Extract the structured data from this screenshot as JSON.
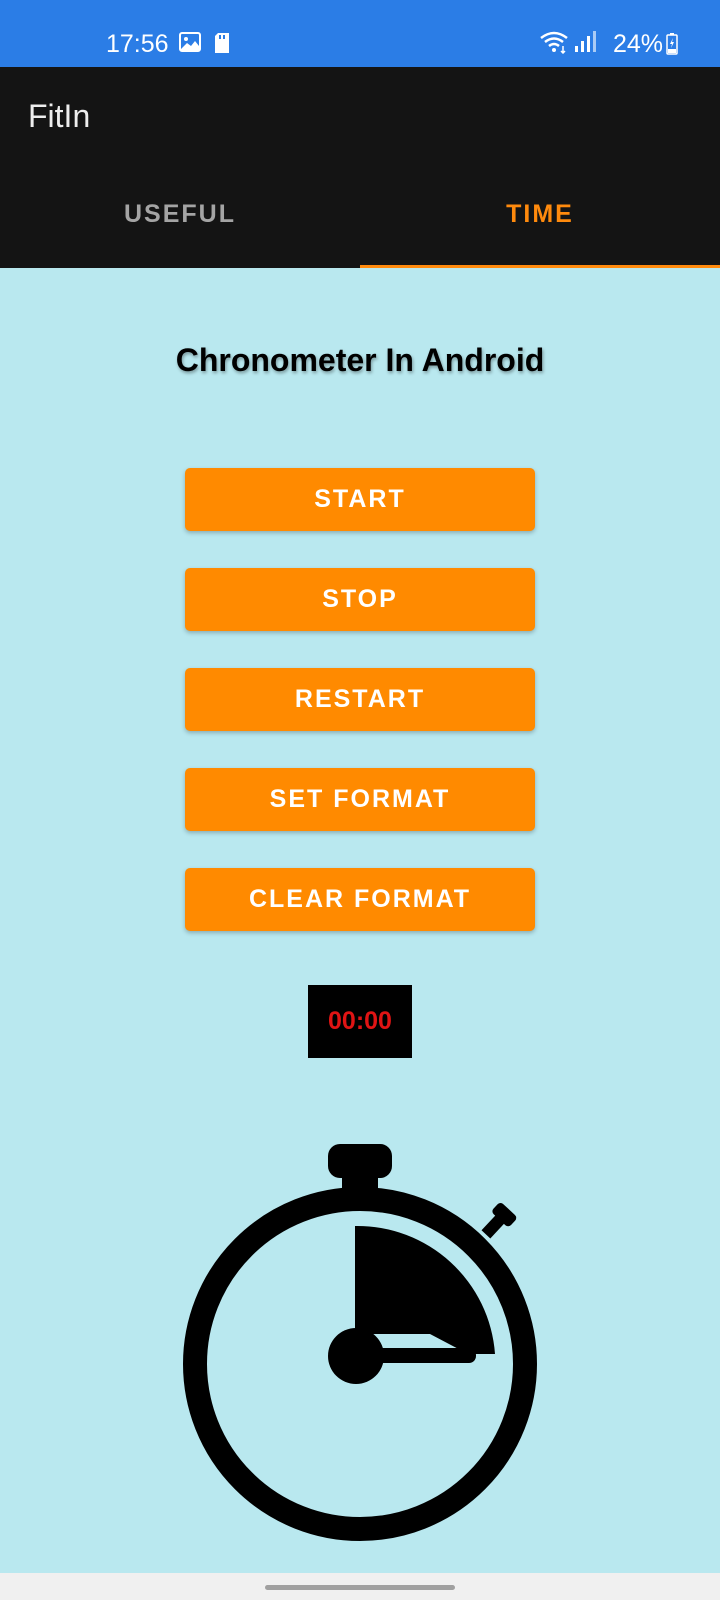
{
  "status_bar": {
    "time": "17:56",
    "battery": "24%",
    "icons": [
      "gallery-icon",
      "sd-card-icon",
      "wifi-icon",
      "signal-icon",
      "battery-icon"
    ]
  },
  "app_bar": {
    "title": "FitIn",
    "tabs": [
      {
        "label": "USEFUL",
        "selected": false
      },
      {
        "label": "TIME",
        "selected": true
      }
    ]
  },
  "main": {
    "heading": "Chronometer In Android",
    "buttons": {
      "start": "START",
      "stop": "STOP",
      "restart": "RESTART",
      "set_format": "SET FORMAT",
      "clear_format": "CLEAR FORMAT"
    },
    "chronometer": "00:00",
    "image_icon": "stopwatch-icon"
  },
  "colors": {
    "status_bar": "#2b7de6",
    "app_bar": "#141414",
    "accent": "#ff8a0d",
    "background": "#b9e8ef",
    "button": "#ff8a00",
    "chronometer_text": "#e01414"
  }
}
